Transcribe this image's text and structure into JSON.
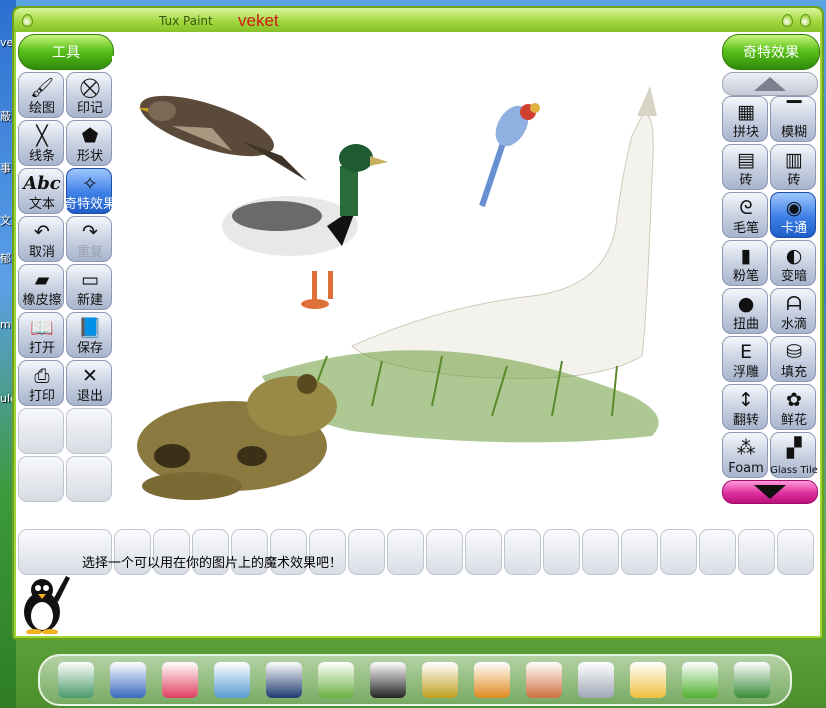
{
  "window": {
    "app_name": "Tux Paint",
    "doc_name": "veket"
  },
  "desktop": {
    "edge_labels": [
      "ve",
      "蔽",
      "事",
      "文",
      "郁",
      "mp",
      "ule"
    ]
  },
  "left_panel": {
    "header": "工具",
    "tools": [
      {
        "label": "绘图",
        "icon": "paintbrush-icon",
        "state": "normal"
      },
      {
        "label": "印记",
        "icon": "stamp-icon",
        "state": "normal"
      },
      {
        "label": "线条",
        "icon": "lines-icon",
        "state": "normal"
      },
      {
        "label": "形状",
        "icon": "pentagon-icon",
        "state": "normal"
      },
      {
        "label": "文本",
        "icon": "text-abc-icon",
        "glyph": "Abc",
        "state": "normal"
      },
      {
        "label": "奇特效果",
        "icon": "magic-wand-icon",
        "state": "selected"
      },
      {
        "label": "取消",
        "icon": "undo-icon",
        "state": "normal"
      },
      {
        "label": "重复",
        "icon": "redo-icon",
        "state": "disabled"
      },
      {
        "label": "橡皮擦",
        "icon": "eraser-icon",
        "state": "normal"
      },
      {
        "label": "新建",
        "icon": "new-page-icon",
        "state": "normal"
      },
      {
        "label": "打开",
        "icon": "open-book-icon",
        "state": "normal"
      },
      {
        "label": "保存",
        "icon": "save-book-icon",
        "state": "normal"
      },
      {
        "label": "打印",
        "icon": "printer-icon",
        "state": "normal"
      },
      {
        "label": "退出",
        "icon": "exit-icon",
        "state": "normal"
      }
    ]
  },
  "right_panel": {
    "header": "奇特效果",
    "effects": [
      {
        "label": "拼块",
        "icon": "mosaic-icon"
      },
      {
        "label": "模糊",
        "icon": "blur-icon"
      },
      {
        "label": "砖",
        "icon": "bricks-small-icon"
      },
      {
        "label": "砖",
        "icon": "bricks-large-icon"
      },
      {
        "label": "毛笔",
        "icon": "calligraphy-icon"
      },
      {
        "label": "卡通",
        "icon": "cartoon-icon",
        "selected": true
      },
      {
        "label": "粉笔",
        "icon": "chalk-icon"
      },
      {
        "label": "变暗",
        "icon": "darken-icon"
      },
      {
        "label": "扭曲",
        "icon": "distortion-icon"
      },
      {
        "label": "水滴",
        "icon": "drip-icon"
      },
      {
        "label": "浮雕",
        "icon": "emboss-icon"
      },
      {
        "label": "填充",
        "icon": "fill-bucket-icon"
      },
      {
        "label": "翻转",
        "icon": "flip-icon"
      },
      {
        "label": "鲜花",
        "icon": "flower-icon"
      },
      {
        "label": "Foam",
        "icon": "foam-icon"
      },
      {
        "label": "Glass Tile",
        "icon": "glass-tile-icon"
      }
    ]
  },
  "status": {
    "instruction": "选择一个可以用在你的图片上的魔术效果吧！"
  },
  "dock": {
    "icons": [
      "graphics-tablet-icon",
      "monitor-icon",
      "pink-pig-icon",
      "paint-editor-icon",
      "speaker-icon",
      "people-chat-icon",
      "penguin-icon",
      "door-exit-icon",
      "presentation-icon",
      "palette-icon",
      "usb-drive-icon",
      "calendar-icon",
      "green-logo-icon",
      "camera-icon"
    ]
  },
  "colors": {
    "accent_green": "#9fd53a",
    "selected_blue": "#3d7fe6",
    "down_arrow_pink": "#e0309f",
    "title_red": "#d01818"
  }
}
